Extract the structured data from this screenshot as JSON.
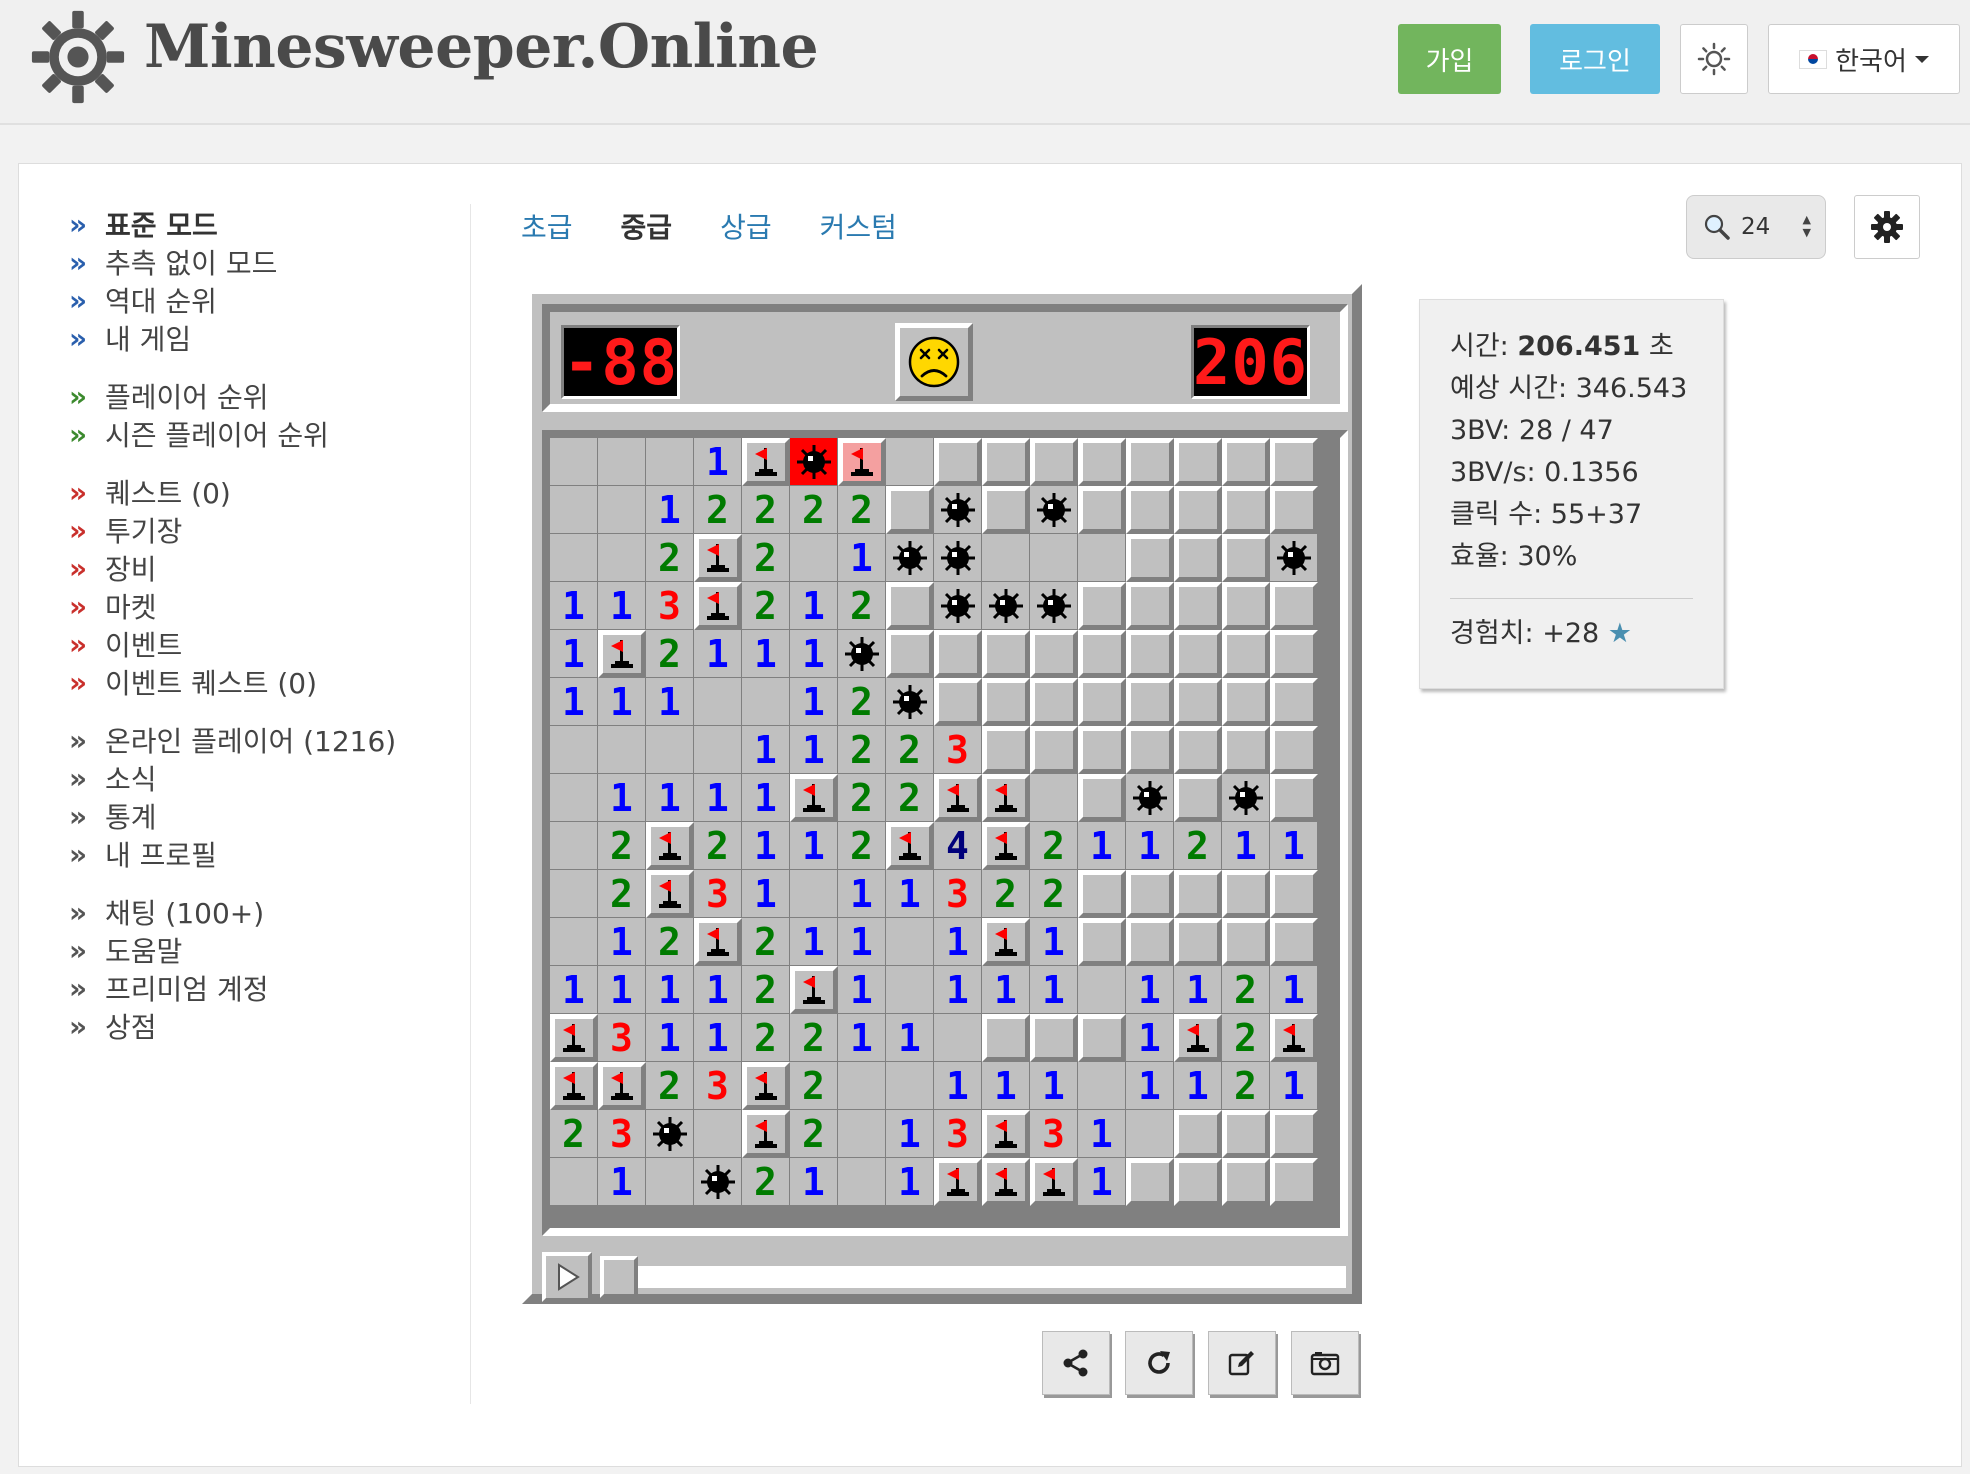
{
  "header": {
    "brand": "Minesweeper.Online",
    "signup": "가입",
    "login": "로그인",
    "language": "한국어",
    "icons": {
      "logo": "gear-mine-logo-icon",
      "theme": "sun-icon",
      "flag": "korea-flag-icon"
    }
  },
  "sidebar": {
    "items": [
      {
        "label": "표준 모드",
        "color": "blue",
        "bold": true
      },
      {
        "label": "추측 없이 모드",
        "color": "blue"
      },
      {
        "label": "역대 순위",
        "color": "blue"
      },
      {
        "label": "내 게임",
        "color": "blue"
      },
      {
        "label": "플레이어 순위",
        "color": "green"
      },
      {
        "label": "시즌 플레이어 순위",
        "color": "green"
      },
      {
        "label": "퀘스트 (0)",
        "color": "red"
      },
      {
        "label": "투기장",
        "color": "red"
      },
      {
        "label": "장비",
        "color": "red"
      },
      {
        "label": "마켓",
        "color": "red"
      },
      {
        "label": "이벤트",
        "color": "red"
      },
      {
        "label": "이벤트 퀘스트 (0)",
        "color": "red"
      },
      {
        "label": "온라인 플레이어 (1216)",
        "color": "grey"
      },
      {
        "label": "소식",
        "color": "grey"
      },
      {
        "label": "통계",
        "color": "grey"
      },
      {
        "label": "내 프로필",
        "color": "grey"
      },
      {
        "label": "채팅 (100+)",
        "color": "grey"
      },
      {
        "label": "도움말",
        "color": "grey"
      },
      {
        "label": "프리미엄 계정",
        "color": "grey"
      },
      {
        "label": "상점",
        "color": "grey"
      }
    ]
  },
  "tabs": [
    {
      "label": "초급",
      "active": false
    },
    {
      "label": "중급",
      "active": true
    },
    {
      "label": "상급",
      "active": false
    },
    {
      "label": "커스텀",
      "active": false
    }
  ],
  "zoom": {
    "value": "24"
  },
  "game": {
    "mines_counter": "-88",
    "timer": "206",
    "face": "dead",
    "board": [
      "...1FXB.........",
      "..12222.*.*.....",
      "..2F2.1**......*",
      "113F212.***.....",
      "1F2111*.........",
      "111..12*........",
      "....11223.......",
      ".1111F22FF..*.*.",
      ".2F2112F4F211211",
      ".2F31.11322.....",
      ".12F211.1F1.....",
      "11112F1.111.1121",
      "F31122110...1F2F",
      "FF23F2..111.1121",
      "23*0F2.13F31....",
      ".10*21.1FFF1...."
    ],
    "closed_mask": [
      "...00000########",
      "0000000#0#0#####",
      "000000000000###0",
      "0000000#000#####",
      "0000000#########",
      "00000000########",
      "000000000#######",
      "00000000000#0#0#",
      "0000000000000000",
      "00000000000#####",
      "00000000000#####",
      "0000000000000000",
      "000000000###0000",
      "0000000000000000",
      "0000000000000###",
      "0#000000000#####"
    ]
  },
  "stats": {
    "time_label": "시간: ",
    "time_value": "206.451",
    "time_unit": " 초",
    "estimated": "예상 시간: 346.543",
    "bbbv": "3BV: 28 / 47",
    "bbbv_s": "3BV/s: 0.1356",
    "clicks": "클릭 수: 55+37",
    "efficiency": "효율: 30%",
    "experience": "경험치: +28",
    "star": "★"
  },
  "actions": {
    "icons": [
      "share-icon",
      "restart-icon",
      "edit-icon",
      "camera-icon"
    ]
  },
  "colors": {
    "signup": "#72b55d",
    "login": "#62bde0",
    "link": "#2a7ab0",
    "exploded_cell": "#ff0000"
  }
}
